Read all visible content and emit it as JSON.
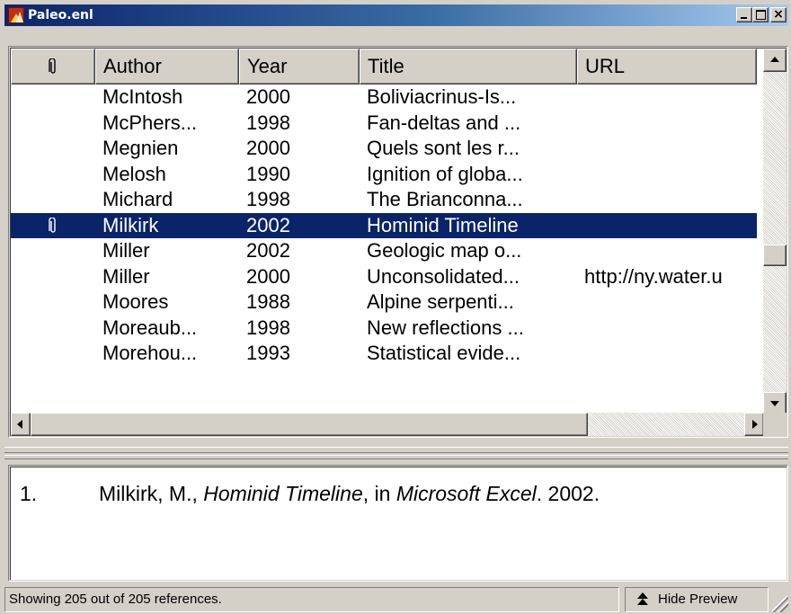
{
  "window": {
    "title": "Paleo.enl",
    "titlebar_gradient": [
      "#0a246a",
      "#a6caf0"
    ]
  },
  "list": {
    "columns": {
      "attachment_icon": "paperclip-icon",
      "author": "Author",
      "year": "Year",
      "title": "Title",
      "url": "URL"
    },
    "rows": [
      {
        "attachment": "",
        "author": "McIntosh",
        "year": "2000",
        "title": "Boliviacrinus-Is...",
        "url": ""
      },
      {
        "attachment": "",
        "author": "McPhers...",
        "year": "1998",
        "title": "Fan-deltas and ...",
        "url": ""
      },
      {
        "attachment": "",
        "author": "Megnien",
        "year": "2000",
        "title": "Quels sont les r...",
        "url": ""
      },
      {
        "attachment": "",
        "author": "Melosh",
        "year": "1990",
        "title": "Ignition of globa...",
        "url": ""
      },
      {
        "attachment": "",
        "author": "Michard",
        "year": "1998",
        "title": "The Brianconna...",
        "url": ""
      },
      {
        "attachment": "paperclip-icon",
        "author": "Milkirk",
        "year": "2002",
        "title": "Hominid Timeline",
        "url": "",
        "selected": true
      },
      {
        "attachment": "",
        "author": "Miller",
        "year": "2002",
        "title": "Geologic map o...",
        "url": ""
      },
      {
        "attachment": "",
        "author": "Miller",
        "year": "2000",
        "title": "Unconsolidated...",
        "url": "http://ny.water.u"
      },
      {
        "attachment": "",
        "author": "Moores",
        "year": "1988",
        "title": "Alpine serpenti...",
        "url": ""
      },
      {
        "attachment": "",
        "author": "Moreaub...",
        "year": "1998",
        "title": "New reflections ...",
        "url": ""
      },
      {
        "attachment": "",
        "author": "Morehou...",
        "year": "1993",
        "title": "Statistical evide...",
        "url": ""
      }
    ],
    "selection_color": "#0a246a"
  },
  "preview": {
    "number": "1.",
    "author": "Milkirk, M., ",
    "title_italic": "Hominid Timeline",
    "middle": ", in ",
    "source_italic": "Microsoft Excel",
    "end": ". 2002."
  },
  "status": {
    "text": "Showing 205 out of 205 references.",
    "hide_preview_label": "Hide Preview"
  }
}
